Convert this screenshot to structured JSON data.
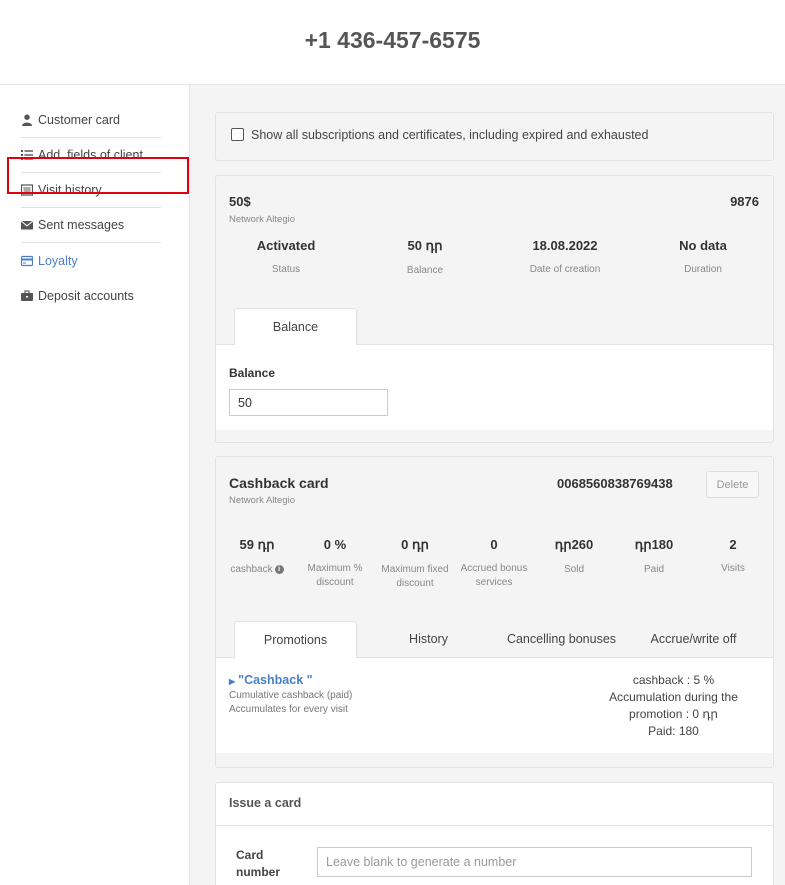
{
  "header": {
    "phone": "+1 436-457-6575"
  },
  "sidebar": {
    "items": [
      {
        "label": "Customer card",
        "icon": "user-icon"
      },
      {
        "label": "Add. fields of client",
        "icon": "list-icon"
      },
      {
        "label": "Visit history",
        "icon": "history-icon"
      },
      {
        "label": "Sent messages",
        "icon": "envelope-icon"
      },
      {
        "label": "Loyalty",
        "icon": "credit-card-icon",
        "active": true
      },
      {
        "label": "Deposit accounts",
        "icon": "briefcase-icon"
      }
    ]
  },
  "filter": {
    "show_all_label": "Show all subscriptions and certificates, including expired and exhausted",
    "checked": false
  },
  "subscription": {
    "title": "50$",
    "network": "Network Altegio",
    "number": "9876",
    "stats": [
      {
        "value": "Activated",
        "label": "Status"
      },
      {
        "value": "50 դր",
        "label": "Balance"
      },
      {
        "value": "18.08.2022",
        "label": "Date of creation"
      },
      {
        "value": "No data",
        "label": "Duration"
      }
    ],
    "tab_label": "Balance",
    "balance_label": "Balance",
    "balance_value": "50"
  },
  "cashback": {
    "title": "Cashback card",
    "network": "Network Altegio",
    "number": "0068560838769438",
    "delete_label": "Delete",
    "stats": [
      {
        "value": "59 դր",
        "label": "cashback"
      },
      {
        "value": "0 %",
        "label": "Maximum % discount"
      },
      {
        "value": "0 դր",
        "label": "Maximum fixed discount"
      },
      {
        "value": "0",
        "label": "Accrued bonus services"
      },
      {
        "value": "դր260",
        "label": "Sold"
      },
      {
        "value": "դր180",
        "label": "Paid"
      },
      {
        "value": "2",
        "label": "Visits"
      }
    ],
    "tabs": [
      "Promotions",
      "History",
      "Cancelling bonuses",
      "Accrue/write off"
    ],
    "promotion": {
      "name": "\"Cashback \"",
      "desc1": "Cumulative cashback (paid)",
      "desc2": "Accumulates for every visit",
      "right1": "cashback : 5 %",
      "right2": "Accumulation during the",
      "right3": "promotion : 0 դր",
      "right4": "Paid: 180"
    }
  },
  "issue": {
    "title": "Issue a card",
    "card_number_label_1": "Card",
    "card_number_label_2": "number",
    "card_number_placeholder": "Leave blank to generate a number"
  },
  "colors": {
    "accent": "#4a7fc8",
    "highlight": "#e0000f",
    "background": "#f4f4f4"
  }
}
